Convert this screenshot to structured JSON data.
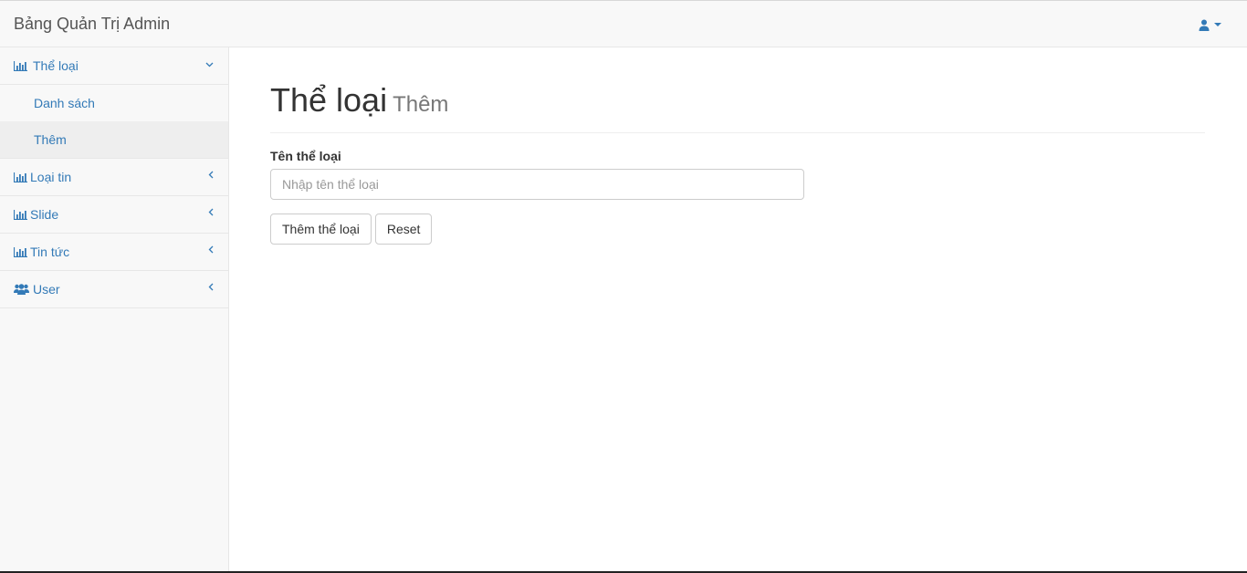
{
  "navbar": {
    "brand": "Bảng Quản Trị Admin",
    "user_icon": "user-icon"
  },
  "sidebar": {
    "items": [
      {
        "label": "Thể loại",
        "icon": "bar-chart-icon",
        "expanded": true,
        "children": [
          {
            "label": "Danh sách"
          },
          {
            "label": "Thêm",
            "active": true
          }
        ]
      },
      {
        "label": "Loại tin",
        "icon": "bar-chart-icon"
      },
      {
        "label": "Slide",
        "icon": "bar-chart-icon"
      },
      {
        "label": "Tin tức",
        "icon": "bar-chart-icon"
      },
      {
        "label": "User",
        "icon": "users-icon"
      }
    ]
  },
  "page": {
    "title": "Thể loại",
    "subtitle": "Thêm"
  },
  "form": {
    "field_label": "Tên thể loại",
    "field_placeholder": "Nhập tên thể loại",
    "field_value": "",
    "submit_label": "Thêm thể loại",
    "reset_label": "Reset"
  },
  "colors": {
    "link": "#337ab7",
    "navbar_bg": "#f8f8f8",
    "active_bg": "#eeeeee"
  }
}
